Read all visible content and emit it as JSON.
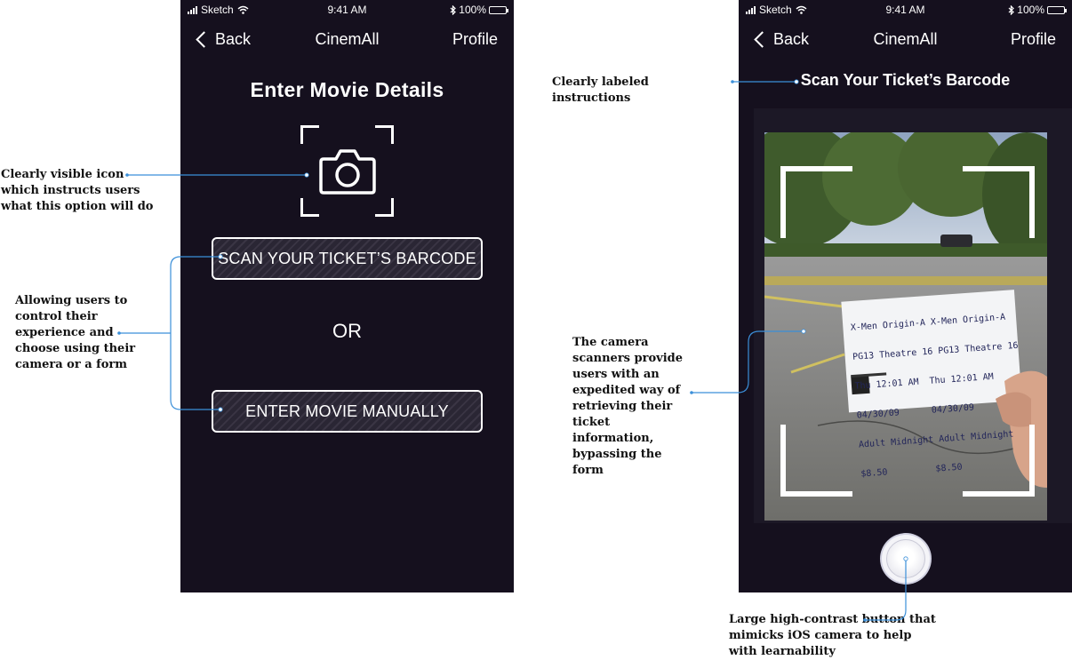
{
  "status_bar": {
    "carrier": "Sketch",
    "time": "9:41 AM",
    "battery": "100%"
  },
  "nav": {
    "back": "Back",
    "title": "CinemAll",
    "profile": "Profile"
  },
  "left_screen": {
    "heading": "Enter Movie Details",
    "scan_button": "SCAN YOUR TICKET’S BARCODE",
    "or_text": "OR",
    "manual_button": "ENTER MOVIE MANUALLY"
  },
  "right_screen": {
    "heading": "Scan Your Ticket’s Barcode",
    "ticket": {
      "line1": "X-Men Origin-A X-Men Origin-A",
      "line2": "PG13 Theatre 16 PG13 Theatre 16",
      "line3": "Thu 12:01 AM  Thu 12:01 AM",
      "line4": "04/30/09      04/30/09",
      "line5": "Adult Midnight Adult Midnight",
      "line6": "$8.50         $8.50"
    }
  },
  "annotations": {
    "icon": "Clearly visible icon which instructs users what this option will do",
    "choice": "Allowing users to control their experience and choose using their camera or a form",
    "instructions": "Clearly labeled instructions",
    "camera": "The camera scanners provide users with an expedited way of retrieving their ticket information, bypassing the form",
    "shutter": "Large high-contrast button that mimicks iOS camera to help with learnability"
  },
  "colors": {
    "background": "#15101e",
    "annotation_line": "#3b8fd9",
    "text": "#ffffff"
  },
  "icons": [
    "signal-bars-icon",
    "wifi-icon",
    "bluetooth-icon",
    "battery-icon",
    "chevron-left-icon",
    "camera-icon",
    "shutter-button-icon"
  ]
}
